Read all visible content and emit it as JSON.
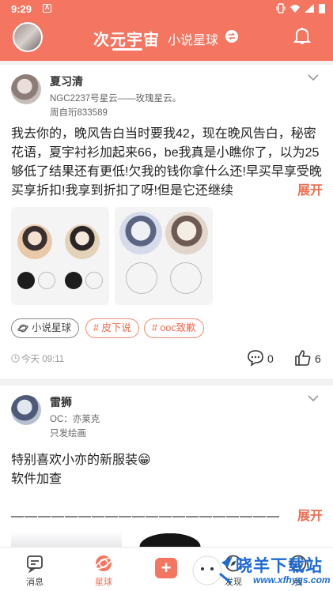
{
  "status_bar": {
    "time": "9:29",
    "notif_letter": "A"
  },
  "header": {
    "tab_active": "次元宇宙",
    "tab_other": "小说星球"
  },
  "post1": {
    "author": "夏习清",
    "sub1": "NGC2237号星云——玫瑰星云。",
    "sub2": "周自珩833589",
    "body": "我去你的，晚风告白当时要我42，现在晚风告白，秘密花语，夏宇衬衫加起来66，be我真是小瞧你了，以为25够低了结果还有更低!欠我的钱你拿什么还!早买早享受晚买享折扣!我享到折扣了呀!但是它还继续",
    "expand": "展开",
    "tags": [
      "小说星球",
      "# 皮下说",
      "# ooc致歉"
    ],
    "time": "今天 09:11",
    "comments": "0",
    "likes": "6"
  },
  "post2": {
    "author": "雷狮",
    "sub1": "OC：亦莱克",
    "sub2": "只发绘画",
    "line1": "特别喜欢小亦的新服装😁",
    "line2": "软件加查",
    "dashes": "————————————————————",
    "expand": "展开"
  },
  "nav": {
    "messages": "消息",
    "planet": "星球",
    "discover": "发现",
    "me": "我"
  },
  "watermark": {
    "text": "晓羊下载站",
    "url": "www.xfhygs.com"
  },
  "colors": {
    "accent": "#f47560",
    "tag_orange": "#f26b4f"
  }
}
